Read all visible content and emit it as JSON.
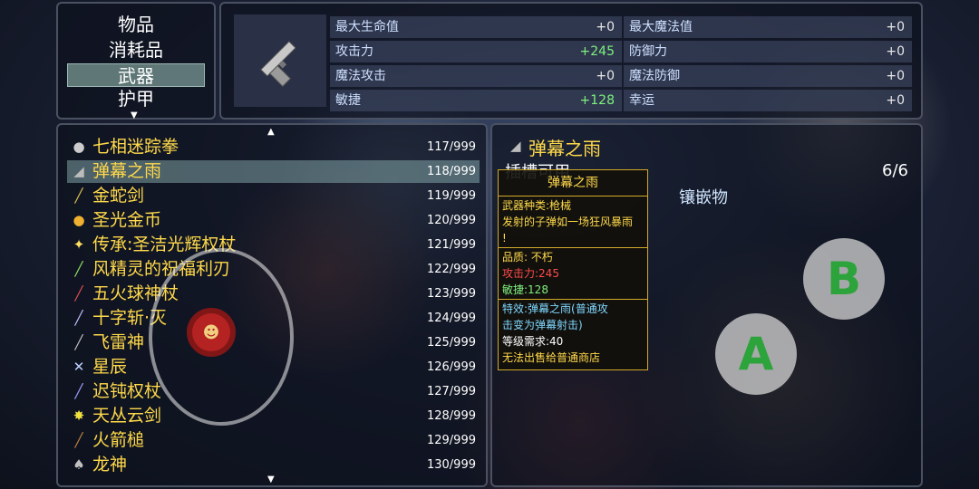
{
  "categories": [
    {
      "label": "物品",
      "selected": false
    },
    {
      "label": "消耗品",
      "selected": false
    },
    {
      "label": "武器",
      "selected": true
    },
    {
      "label": "护甲",
      "selected": false
    }
  ],
  "stats": [
    {
      "label": "最大生命值",
      "value": "+0"
    },
    {
      "label": "最大魔法值",
      "value": "+0"
    },
    {
      "label": "攻击力",
      "value": "+245"
    },
    {
      "label": "防御力",
      "value": "+0"
    },
    {
      "label": "魔法攻击",
      "value": "+0"
    },
    {
      "label": "魔法防御",
      "value": "+0"
    },
    {
      "label": "敏捷",
      "value": "+128"
    },
    {
      "label": "幸运",
      "value": "+0"
    }
  ],
  "items": [
    {
      "name": "七相迷踪拳",
      "count": "117/999",
      "icon": "fist-icon",
      "glyph": "●",
      "color": "#cccccc",
      "selected": false
    },
    {
      "name": "弹幕之雨",
      "count": "118/999",
      "icon": "gun-icon",
      "glyph": "◢",
      "color": "#bbbbbb",
      "selected": true
    },
    {
      "name": "金蛇剑",
      "count": "119/999",
      "icon": "sword-icon",
      "glyph": "╱",
      "color": "#e0c050",
      "selected": false
    },
    {
      "name": "圣光金币",
      "count": "120/999",
      "icon": "coin-icon",
      "glyph": "●",
      "color": "#f0b030",
      "selected": false
    },
    {
      "name": "传承:圣洁光辉权杖",
      "count": "121/999",
      "icon": "scepter-icon",
      "glyph": "✦",
      "color": "#ffe060",
      "selected": false
    },
    {
      "name": "风精灵的祝福利刃",
      "count": "122/999",
      "icon": "blade-icon",
      "glyph": "╱",
      "color": "#90e060",
      "selected": false
    },
    {
      "name": "五火球神杖",
      "count": "123/999",
      "icon": "staff-icon",
      "glyph": "╱",
      "color": "#e05050",
      "selected": false
    },
    {
      "name": "十字斩·灭",
      "count": "124/999",
      "icon": "sword-icon",
      "glyph": "╱",
      "color": "#c0c0ff",
      "selected": false
    },
    {
      "name": "飞雷神",
      "count": "125/999",
      "icon": "kunai-icon",
      "glyph": "╱",
      "color": "#c0c0c0",
      "selected": false
    },
    {
      "name": "星辰",
      "count": "126/999",
      "icon": "crossed-swords-icon",
      "glyph": "✕",
      "color": "#c0d0ff",
      "selected": false
    },
    {
      "name": "迟钝权杖",
      "count": "127/999",
      "icon": "staff-icon",
      "glyph": "╱",
      "color": "#a0a0ff",
      "selected": false
    },
    {
      "name": "天丛云剑",
      "count": "128/999",
      "icon": "sword-icon",
      "glyph": "✸",
      "color": "#f0e040",
      "selected": false
    },
    {
      "name": "火箭槌",
      "count": "129/999",
      "icon": "hammer-icon",
      "glyph": "╱",
      "color": "#c08040",
      "selected": false
    },
    {
      "name": "龙神",
      "count": "130/999",
      "icon": "axe-icon",
      "glyph": "♠",
      "color": "#c0c0c0",
      "selected": false
    }
  ],
  "detail": {
    "title": "弹幕之雨",
    "subtitle": "插槽可用",
    "slot_count": "6/6",
    "inlay_label": "镶嵌物"
  },
  "tooltip": {
    "title": "弹幕之雨",
    "weapon_type": "武器种类:枪械",
    "desc": "发射的子弹如一场狂风暴雨",
    "desc_end": "!",
    "quality": "品质: 不朽",
    "atk": "攻击力:245",
    "agi": "敏捷:128",
    "effect_line1": "特效:弹幕之雨(普通攻",
    "effect_line2": "击变为弹幕射击)",
    "level_req": "等级需求:40",
    "sell_note": "无法出售给普通商店"
  },
  "controls": {
    "button_a": "A",
    "button_b": "B"
  },
  "colors": {
    "name_yellow": "#ffd94a",
    "stat_up": "#7ef07e",
    "tooltip_border": "#d2aa2a",
    "button_letter": "#2da33b"
  }
}
